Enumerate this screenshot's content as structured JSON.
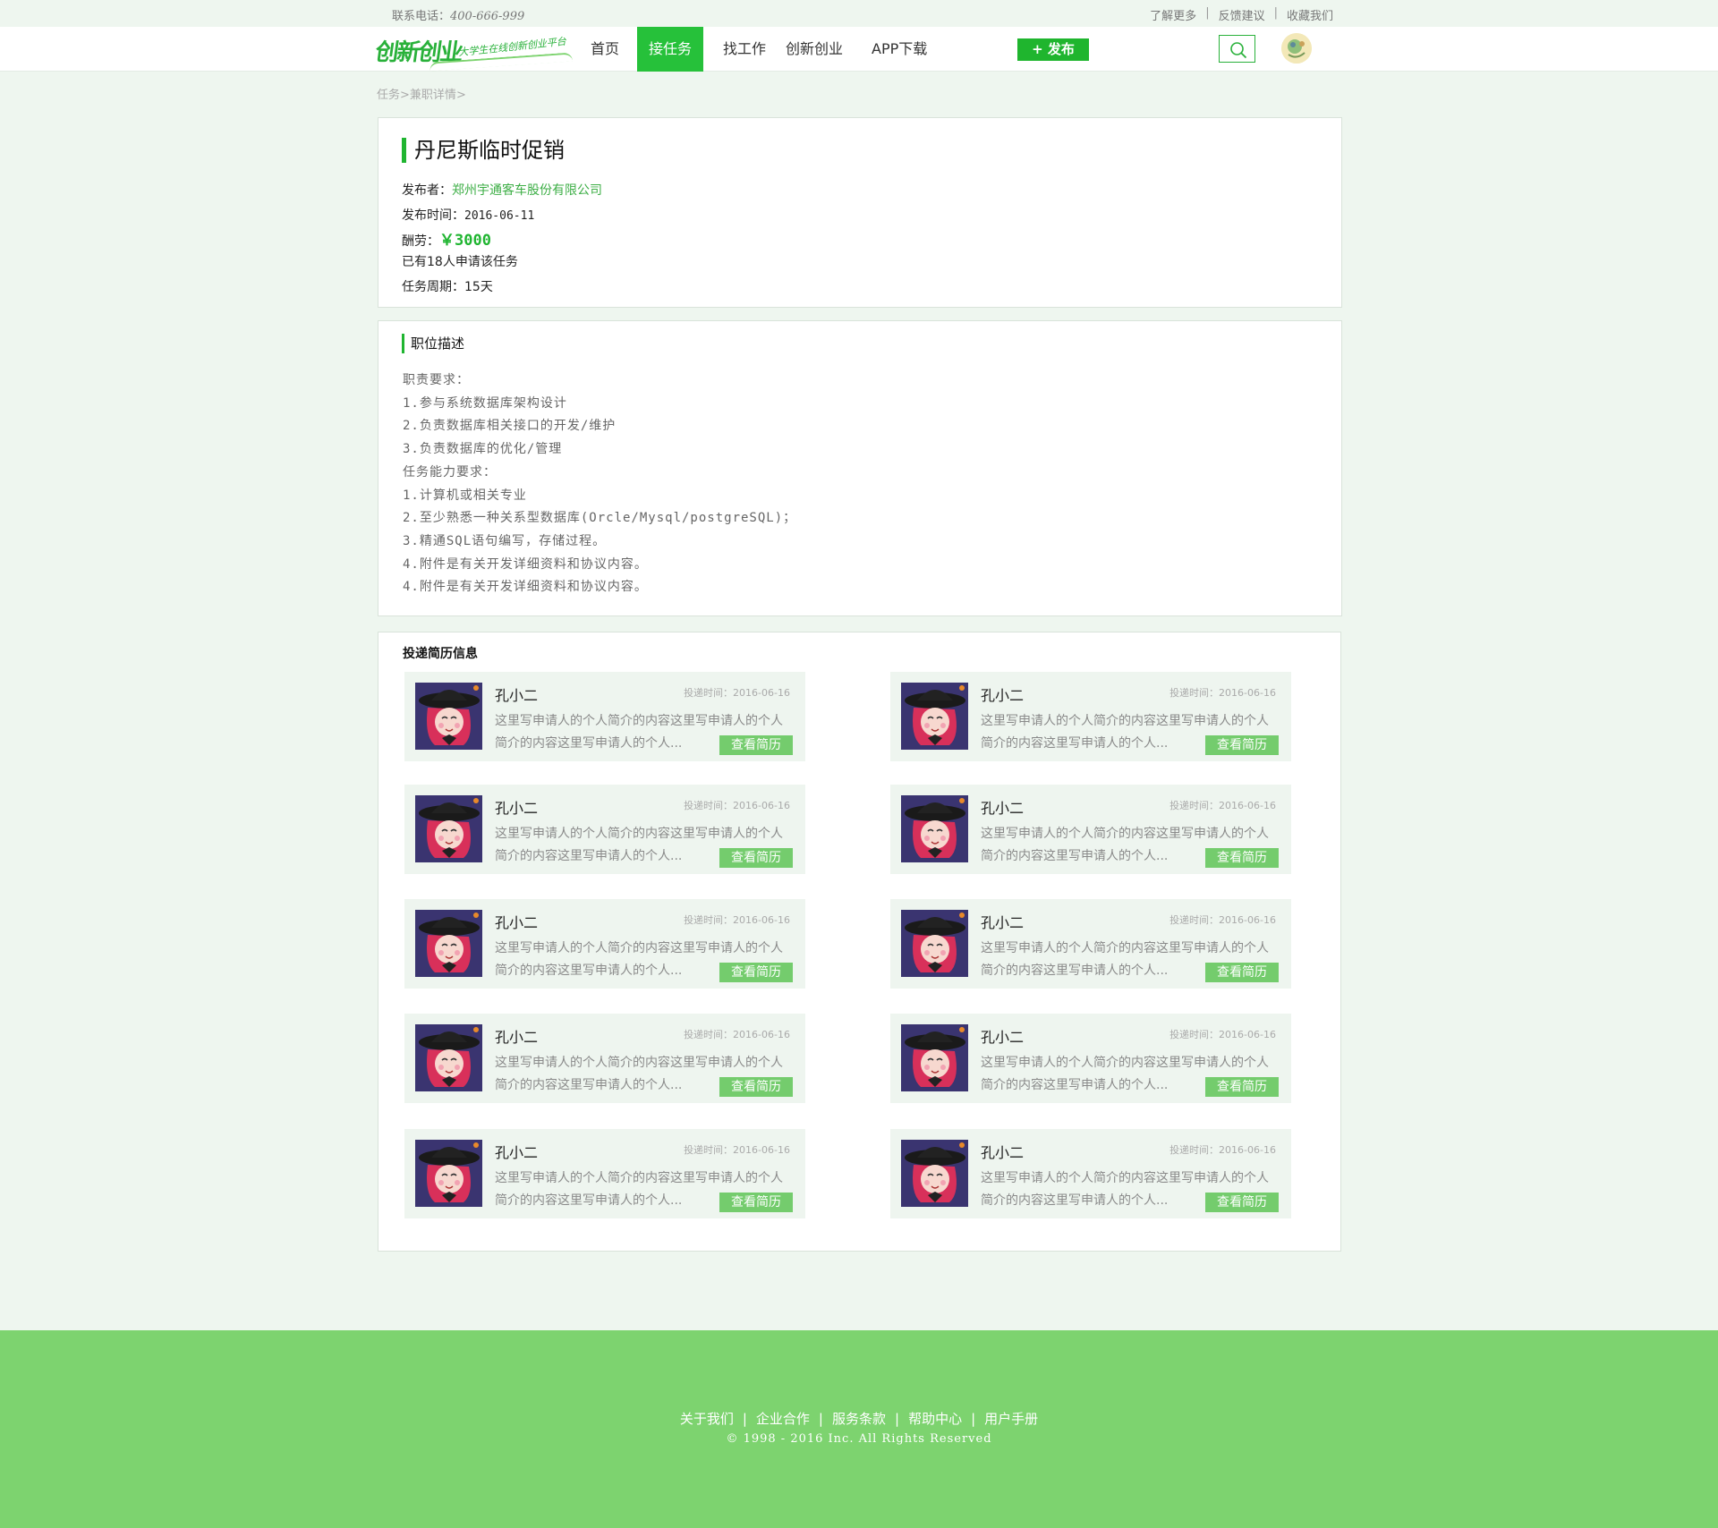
{
  "topbar": {
    "phone_label": "联系电话：",
    "phone_number": "400-666-999",
    "links": [
      "了解更多",
      "反馈建议",
      "收藏我们"
    ]
  },
  "header": {
    "logo_text": "创新创业",
    "logo_slogan": "大学生在线创新创业平台",
    "nav": [
      "首页",
      "接任务",
      "找工作",
      "创新创业",
      "APP下载"
    ],
    "nav_active_index": 1,
    "publish_label": "+ 发布",
    "accent_color": "#26c13a"
  },
  "breadcrumb": {
    "level1": "任务",
    "level2": "兼职详情"
  },
  "job": {
    "title": "丹尼斯临时促销",
    "publisher_label": "发布者：",
    "publisher": "郑州宇通客车股份有限公司",
    "time_label": "发布时间：",
    "time": "2016-06-11",
    "salary_label": "酬劳：",
    "salary": "￥3000",
    "applicants": "已有18人申请该任务",
    "period_label": "任务周期：",
    "period": "15天"
  },
  "description": {
    "title": "职位描述",
    "lines": [
      "职责要求：",
      "1.参与系统数据库架构设计",
      "2.负责数据库相关接口的开发/维护",
      "3.负责数据库的优化/管理",
      "任务能力要求：",
      "1.计算机或相关专业",
      "2.至少熟悉一种关系型数据库(Orcle/Mysql/postgreSQL)；",
      "3.精通SQL语句编写，存储过程。",
      "4.附件是有关开发详细资料和协议内容。",
      "4.附件是有关开发详细资料和协议内容。"
    ]
  },
  "resumes": {
    "title": "投递简历信息",
    "items": [
      {
        "name": "孔小二",
        "time": "投递时间：2016-06-16",
        "bio": "这里写申请人的个人简介的内容这里写申请人的个人简介的内容这里写申请人的个人...",
        "button": "查看简历"
      },
      {
        "name": "孔小二",
        "time": "投递时间：2016-06-16",
        "bio": "这里写申请人的个人简介的内容这里写申请人的个人简介的内容这里写申请人的个人...",
        "button": "查看简历"
      },
      {
        "name": "孔小二",
        "time": "投递时间：2016-06-16",
        "bio": "这里写申请人的个人简介的内容这里写申请人的个人简介的内容这里写申请人的个人...",
        "button": "查看简历"
      },
      {
        "name": "孔小二",
        "time": "投递时间：2016-06-16",
        "bio": "这里写申请人的个人简介的内容这里写申请人的个人简介的内容这里写申请人的个人...",
        "button": "查看简历"
      },
      {
        "name": "孔小二",
        "time": "投递时间：2016-06-16",
        "bio": "这里写申请人的个人简介的内容这里写申请人的个人简介的内容这里写申请人的个人...",
        "button": "查看简历"
      },
      {
        "name": "孔小二",
        "time": "投递时间：2016-06-16",
        "bio": "这里写申请人的个人简介的内容这里写申请人的个人简介的内容这里写申请人的个人...",
        "button": "查看简历"
      },
      {
        "name": "孔小二",
        "time": "投递时间：2016-06-16",
        "bio": "这里写申请人的个人简介的内容这里写申请人的个人简介的内容这里写申请人的个人...",
        "button": "查看简历"
      },
      {
        "name": "孔小二",
        "time": "投递时间：2016-06-16",
        "bio": "这里写申请人的个人简介的内容这里写申请人的个人简介的内容这里写申请人的个人...",
        "button": "查看简历"
      },
      {
        "name": "孔小二",
        "time": "投递时间：2016-06-16",
        "bio": "这里写申请人的个人简介的内容这里写申请人的个人简介的内容这里写申请人的个人...",
        "button": "查看简历"
      },
      {
        "name": "孔小二",
        "time": "投递时间：2016-06-16",
        "bio": "这里写申请人的个人简介的内容这里写申请人的个人简介的内容这里写申请人的个人...",
        "button": "查看简历"
      }
    ]
  },
  "footer": {
    "links": [
      "关于我们",
      "企业合作",
      "服务条款",
      "帮助中心",
      "用户手册"
    ],
    "copyright": "© 1998 - 2016  Inc. All Rights Reserved",
    "background_color": "#7dd36f"
  }
}
